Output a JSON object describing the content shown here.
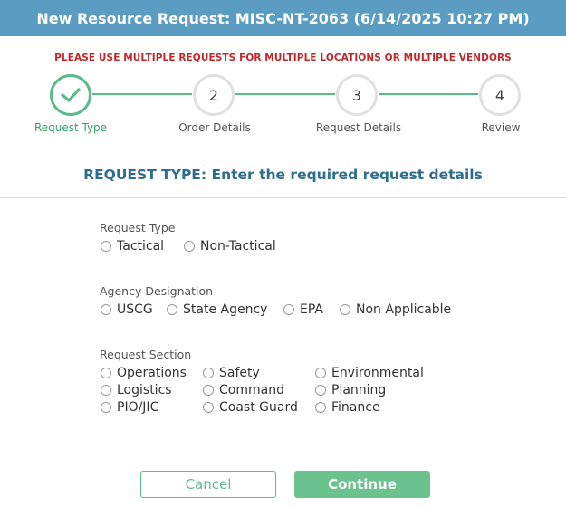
{
  "header": {
    "title": "New Resource Request: MISC-NT-2063 (6/14/2025 10:27 PM)"
  },
  "warning": "PLEASE USE MULTIPLE REQUESTS FOR MULTIPLE LOCATIONS OR MULTIPLE VENDORS",
  "stepper": {
    "steps": [
      {
        "number": "1",
        "label": "Request Type",
        "status": "complete"
      },
      {
        "number": "2",
        "label": "Order Details",
        "status": "pending"
      },
      {
        "number": "3",
        "label": "Request Details",
        "status": "pending"
      },
      {
        "number": "4",
        "label": "Review",
        "status": "pending"
      }
    ]
  },
  "section_title": "REQUEST TYPE: Enter the required request details",
  "request_type": {
    "label": "Request Type",
    "options": [
      "Tactical",
      "Non-Tactical"
    ],
    "selected": null
  },
  "agency": {
    "label": "Agency Designation",
    "options": [
      "USCG",
      "State Agency",
      "EPA",
      "Non Applicable"
    ],
    "selected": null
  },
  "section": {
    "label": "Request Section",
    "options": [
      "Operations",
      "Safety",
      "Environmental",
      "Logistics",
      "Command",
      "Planning",
      "PIO/JIC",
      "Coast Guard",
      "Finance"
    ],
    "selected": null
  },
  "buttons": {
    "cancel": "Cancel",
    "continue": "Continue"
  },
  "colors": {
    "header": "#5b9cc2",
    "accent": "#5aba8a",
    "warning": "#c0282a",
    "title": "#2f6d8c"
  }
}
